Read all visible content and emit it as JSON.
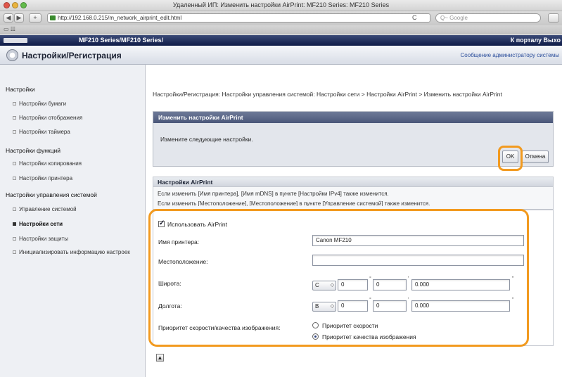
{
  "window": {
    "title": "Удаленный ИП: Изменить настройки AirPrint: MF210 Series: MF210 Series"
  },
  "toolbar": {
    "back_label": "◀",
    "forward_label": "▶",
    "add_label": "+",
    "url": "http://192.168.0.215/m_network_airprint_edit.html",
    "reload_label": "C",
    "search_placeholder": "Q~ Google"
  },
  "bookmarks": {
    "label": "▭ ☷"
  },
  "canon_bar": {
    "device": "MF210 Series/MF210 Series/",
    "portal_link": "К порталу Выхо"
  },
  "header": {
    "title": "Настройки/Регистрация",
    "admin_message": "Сообщение администратору системы"
  },
  "sidebar": {
    "groups": [
      {
        "heading": "Настройки",
        "items": [
          "Настройки бумаги",
          "Настройки отображения",
          "Настройки таймера"
        ]
      },
      {
        "heading": "Настройки функций",
        "items": [
          "Настройки копирования",
          "Настройки принтера"
        ]
      },
      {
        "heading": "Настройки управления системой",
        "items": [
          "Управление системой",
          "Настройки сети",
          "Настройки защиты",
          "Инициализировать информацию настроек"
        ]
      }
    ]
  },
  "breadcrumb": "Настройки/Регистрация: Настройки управления системой: Настройки сети > Настройки AirPrint > Изменить настройки AirPrint",
  "panel_edit": {
    "title": "Изменить настройки AirPrint",
    "text": "Измените следующие настройки.",
    "ok_label": "OK",
    "cancel_label": "Отмена"
  },
  "panel_airprint": {
    "title": "Настройки AirPrint",
    "line1": "Если изменить [Имя принтера], [Имя mDNS] в пункте [Настройки IPv4] также изменится.",
    "line2": "Если изменить [Местоположение], [Местоположение] в пункте [Управление системой] также изменится."
  },
  "form": {
    "use_airprint_label": "Использовать AirPrint",
    "printer_name_label": "Имя принтера:",
    "printer_name_value": "Canon MF210",
    "location_label": "Местоположение:",
    "location_value": "",
    "latitude_label": "Широта:",
    "latitude_dir": "C",
    "latitude_deg": "0",
    "latitude_min": "0",
    "latitude_sec": "0.000",
    "longitude_label": "Долгота:",
    "longitude_dir": "В",
    "longitude_deg": "0",
    "longitude_min": "0",
    "longitude_sec": "0.000",
    "priority_label": "Приоритет скорости/качества изображения:",
    "priority_speed": "Приоритет скорости",
    "priority_quality": "Приоритет качества изображения"
  },
  "footer": {
    "top_icon": "▲"
  }
}
